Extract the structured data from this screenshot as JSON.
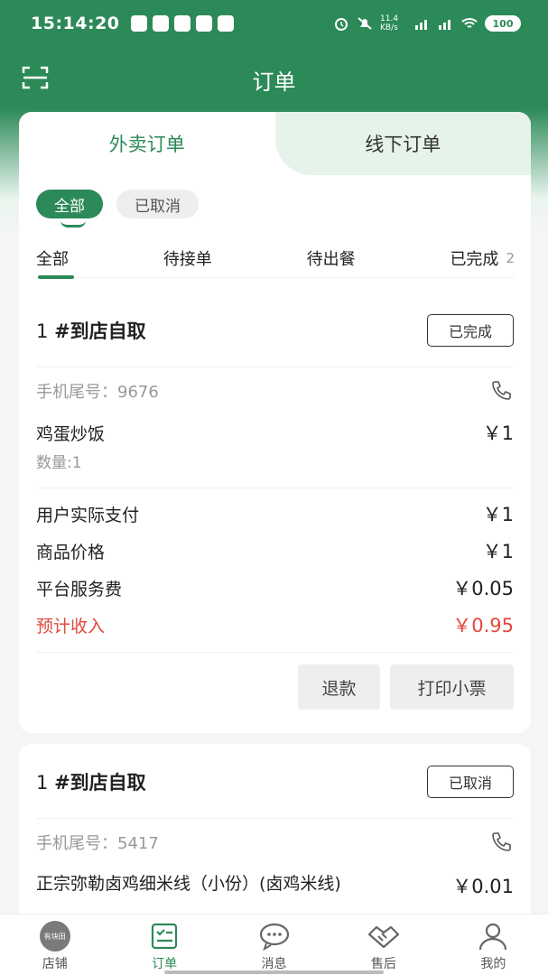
{
  "status_bar": {
    "time": "15:14:20",
    "speed": "11.4 KB/s",
    "battery": "100"
  },
  "header": {
    "title": "订单"
  },
  "top_tabs": [
    {
      "label": "外卖订单",
      "active": true
    },
    {
      "label": "线下订单",
      "active": false
    }
  ],
  "filter_pills": [
    {
      "label": "全部",
      "active": true
    },
    {
      "label": "已取消",
      "active": false
    }
  ],
  "status_tabs": [
    {
      "label": "全部",
      "active": true,
      "count": ""
    },
    {
      "label": "待接单",
      "active": false,
      "count": ""
    },
    {
      "label": "待出餐",
      "active": false,
      "count": ""
    },
    {
      "label": "已完成",
      "active": false,
      "count": "2"
    }
  ],
  "orders": [
    {
      "number": "1",
      "type": "#到店自取",
      "status": "已完成",
      "phone_label": "手机尾号：",
      "phone_tail": "9676",
      "item_name": "鸡蛋炒饭",
      "item_price": "￥1",
      "item_qty": "数量:1",
      "user_paid_label": "用户实际支付",
      "user_paid": "￥1",
      "goods_price_label": "商品价格",
      "goods_price": "￥1",
      "service_fee_label": "平台服务费",
      "service_fee": "￥0.05",
      "income_label": "预计收入",
      "income": "￥0.95",
      "refund_label": "退款",
      "print_label": "打印小票"
    },
    {
      "number": "1",
      "type": "#到店自取",
      "status": "已取消",
      "phone_label": "手机尾号：",
      "phone_tail": "5417",
      "item_name": "正宗弥勒卤鸡细米线（小份）(卤鸡米线)",
      "item_price": "￥0.01"
    }
  ],
  "tabbar": [
    {
      "label": "店铺",
      "icon": "shop-logo-icon",
      "logo_text": "有块田",
      "active": false
    },
    {
      "label": "订单",
      "icon": "order-list-icon",
      "active": true
    },
    {
      "label": "消息",
      "icon": "message-icon",
      "active": false
    },
    {
      "label": "售后",
      "icon": "handshake-icon",
      "active": false
    },
    {
      "label": "我的",
      "icon": "user-icon",
      "active": false
    }
  ],
  "colors": {
    "brand": "#2c8a58",
    "red": "#e04a3c"
  }
}
